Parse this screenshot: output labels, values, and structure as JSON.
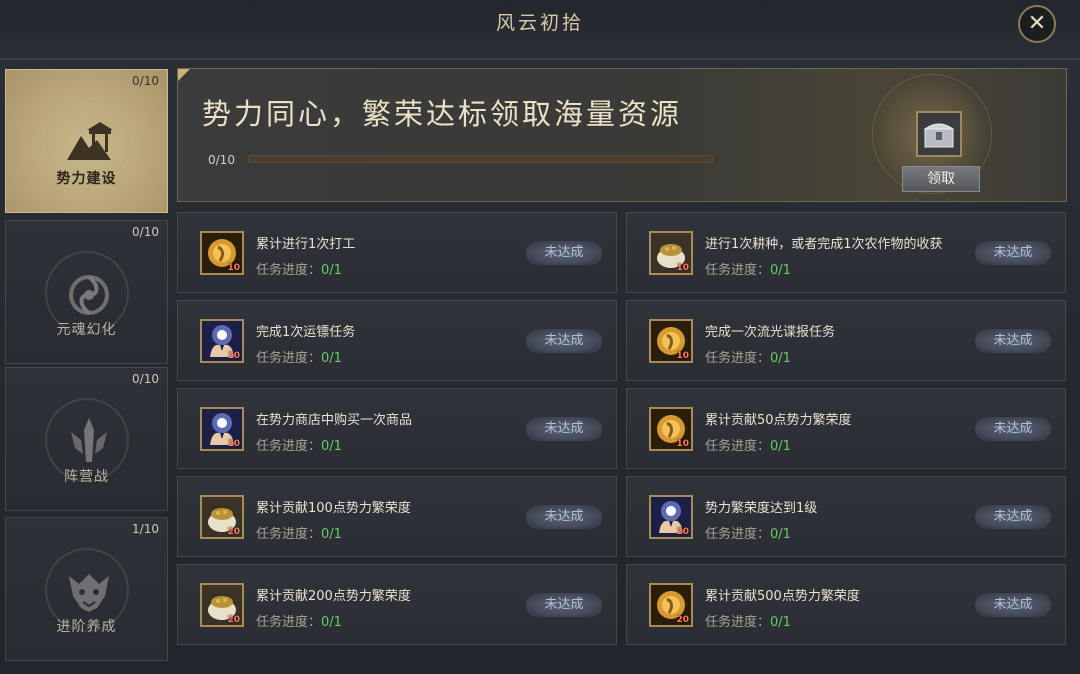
{
  "window": {
    "title": "风云初拾"
  },
  "sidebar": {
    "items": [
      {
        "label": "势力建设",
        "count": "0/10",
        "active": true
      },
      {
        "label": "元魂幻化",
        "count": "0/10",
        "active": false
      },
      {
        "label": "阵营战",
        "count": "0/10",
        "active": false
      },
      {
        "label": "进阶养成",
        "count": "1/10",
        "active": false
      }
    ]
  },
  "banner": {
    "title": "势力同心，繁荣达标领取海量资源",
    "progress_text": "0/10",
    "progress": 0,
    "reward_icon": "silver-chest-icon",
    "claim_label": "领取"
  },
  "tasks": [
    {
      "name": "累计进行1次打工",
      "progress_label": "任务进度：",
      "progress": "0/1",
      "qty": "10",
      "icon": "gold-coin-icon",
      "status": "未达成"
    },
    {
      "name": "进行1次耕种，或者完成1次农作物的收获",
      "progress_label": "任务进度：",
      "progress": "0/1",
      "qty": "10",
      "icon": "grain-sack-icon",
      "status": "未达成"
    },
    {
      "name": "完成1次运镖任务",
      "progress_label": "任务进度：",
      "progress": "0/1",
      "qty": "10",
      "icon": "glowing-hands-icon",
      "status": "未达成"
    },
    {
      "name": "完成一次流光谍报任务",
      "progress_label": "任务进度：",
      "progress": "0/1",
      "qty": "10",
      "icon": "gold-coin-icon",
      "status": "未达成"
    },
    {
      "name": "在势力商店中购买一次商品",
      "progress_label": "任务进度：",
      "progress": "0/1",
      "qty": "10",
      "icon": "glowing-hands-icon",
      "status": "未达成"
    },
    {
      "name": "累计贡献50点势力繁荣度",
      "progress_label": "任务进度：",
      "progress": "0/1",
      "qty": "10",
      "icon": "gold-coin-icon",
      "status": "未达成"
    },
    {
      "name": "累计贡献100点势力繁荣度",
      "progress_label": "任务进度：",
      "progress": "0/1",
      "qty": "20",
      "icon": "grain-sack-icon",
      "status": "未达成"
    },
    {
      "name": "势力繁荣度达到1级",
      "progress_label": "任务进度：",
      "progress": "0/1",
      "qty": "20",
      "icon": "glowing-hands-icon",
      "status": "未达成"
    },
    {
      "name": "累计贡献200点势力繁荣度",
      "progress_label": "任务进度：",
      "progress": "0/1",
      "qty": "20",
      "icon": "grain-sack-icon",
      "status": "未达成"
    },
    {
      "name": "累计贡献500点势力繁荣度",
      "progress_label": "任务进度：",
      "progress": "0/1",
      "qty": "20",
      "icon": "gold-coin-icon",
      "status": "未达成"
    }
  ]
}
